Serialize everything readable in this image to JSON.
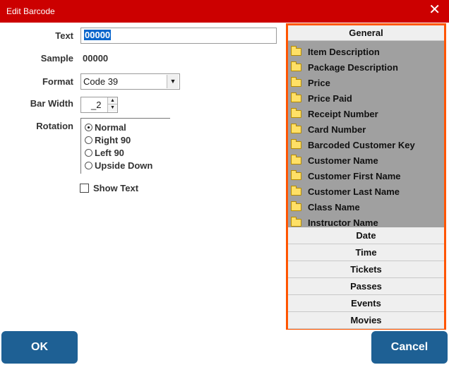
{
  "window": {
    "title": "Edit Barcode",
    "close_glyph": "✕"
  },
  "form": {
    "text_label": "Text",
    "text_value": "00000",
    "sample_label": "Sample",
    "sample_value": "00000",
    "format_label": "Format",
    "format_value": "Code 39",
    "bar_width_label": "Bar Width",
    "bar_width_value": "_2",
    "rotation_label": "Rotation",
    "rotation_options": [
      "Normal",
      "Right 90",
      "Left 90",
      "Upside Down"
    ],
    "rotation_selected": "Normal",
    "show_text_label": "Show Text",
    "show_text_checked": false
  },
  "panel": {
    "sections": [
      "General",
      "Date",
      "Time",
      "Tickets",
      "Passes",
      "Events",
      "Movies"
    ],
    "active_section": "General",
    "general_items": [
      "Item Description",
      "Package Description",
      "Price",
      "Price Paid",
      "Receipt Number",
      "Card Number",
      "Barcoded Customer Key",
      "Customer Name",
      "Customer First Name",
      "Customer Last Name",
      "Class Name",
      "Instructor Name"
    ],
    "highlight_color": "#ff5500"
  },
  "buttons": {
    "ok_label": "OK",
    "cancel_label": "Cancel",
    "color": "#1e6094"
  },
  "icons": {
    "folder": "folder-icon",
    "close": "close-icon"
  }
}
